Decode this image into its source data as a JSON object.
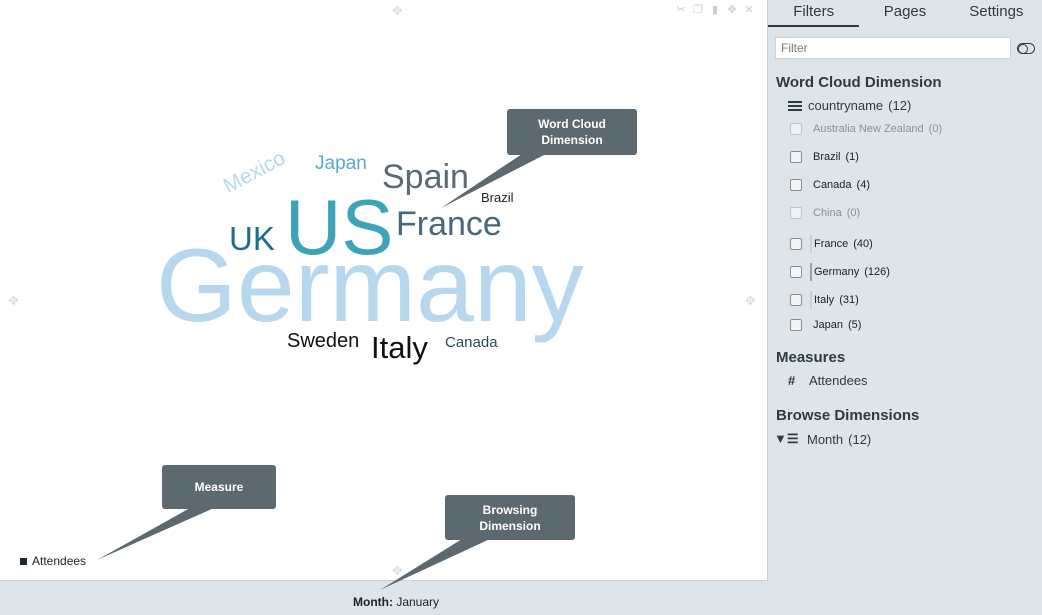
{
  "toolbar_icons": [
    "scissors-icon",
    "copy-icon",
    "chart-icon",
    "move-icon",
    "close-icon"
  ],
  "wordcloud": {
    "words": [
      {
        "text": "Germany",
        "color": "#b7d7ef"
      },
      {
        "text": "US",
        "color": "#3fa3b7"
      },
      {
        "text": "Spain",
        "color": "#5b6b73"
      },
      {
        "text": "France",
        "color": "#46697c"
      },
      {
        "text": "UK",
        "color": "#1f6c8c"
      },
      {
        "text": "Italy",
        "color": "#111111"
      },
      {
        "text": "Sweden",
        "color": "#111111"
      },
      {
        "text": "Canada",
        "color": "#2a4a57"
      },
      {
        "text": "Brazil",
        "color": "#222222"
      },
      {
        "text": "Japan",
        "color": "#5ea8c2"
      },
      {
        "text": "Mexico",
        "color": "#b7d7ef"
      }
    ]
  },
  "legend": {
    "label": "Attendees"
  },
  "browse": {
    "label_prefix": "Month:",
    "value": "January"
  },
  "callouts": {
    "wordcloud": "Word Cloud Dimension",
    "measure": "Measure",
    "browsing": "Browsing Dimension"
  },
  "sidebar": {
    "tabs": [
      {
        "label": "Filters",
        "active": true
      },
      {
        "label": "Pages",
        "active": false
      },
      {
        "label": "Settings",
        "active": false
      }
    ],
    "filter_placeholder": "Filter",
    "wordcloud_section": {
      "title": "Word Cloud Dimension",
      "field": "countryname",
      "field_count": "(12)",
      "items": [
        {
          "label": "Australia New Zealand",
          "count": "(0)",
          "disabled": true,
          "bar": ""
        },
        {
          "label": "Brazil",
          "count": "(1)",
          "disabled": false,
          "bar": ""
        },
        {
          "label": "Canada",
          "count": "(4)",
          "disabled": false,
          "bar": ""
        },
        {
          "label": "China",
          "count": "(0)",
          "disabled": true,
          "bar": ""
        },
        {
          "label": "France",
          "count": "(40)",
          "disabled": false,
          "bar": "#c9cfd4"
        },
        {
          "label": "Germany",
          "count": "(126)",
          "disabled": false,
          "bar": "#9aa3aa"
        },
        {
          "label": "Italy",
          "count": "(31)",
          "disabled": false,
          "bar": "#c9cfd4"
        },
        {
          "label": "Japan",
          "count": "(5)",
          "disabled": false,
          "bar": ""
        }
      ]
    },
    "measures_section": {
      "title": "Measures",
      "field": "Attendees",
      "icon": "hash-icon"
    },
    "browse_section": {
      "title": "Browse Dimensions",
      "field": "Month",
      "field_count": "(12)",
      "icon": "filter-list-icon"
    }
  }
}
